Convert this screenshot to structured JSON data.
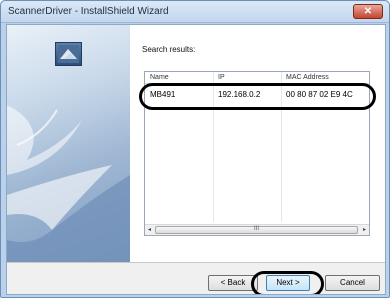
{
  "window": {
    "title": "ScannerDriver - InstallShield Wizard",
    "close_label": "✕"
  },
  "main": {
    "search_label": "Search results:",
    "columns": [
      "Name",
      "IP",
      "MAC Address"
    ],
    "rows": [
      {
        "name": "MB491",
        "ip": "192.168.0.2",
        "mac": "00 80 87 02 E9 4C"
      }
    ],
    "scrollbar": {
      "left_arrow": "◂",
      "right_arrow": "▸",
      "grip": "III"
    }
  },
  "buttons": {
    "back_label": "< Back",
    "next_label": "Next >",
    "cancel_label": "Cancel"
  },
  "colors": {
    "title_bar": "#c2d6ee",
    "close_button": "#c5452d",
    "side_panel": "#9fb7d3",
    "highlight": "#000000"
  }
}
